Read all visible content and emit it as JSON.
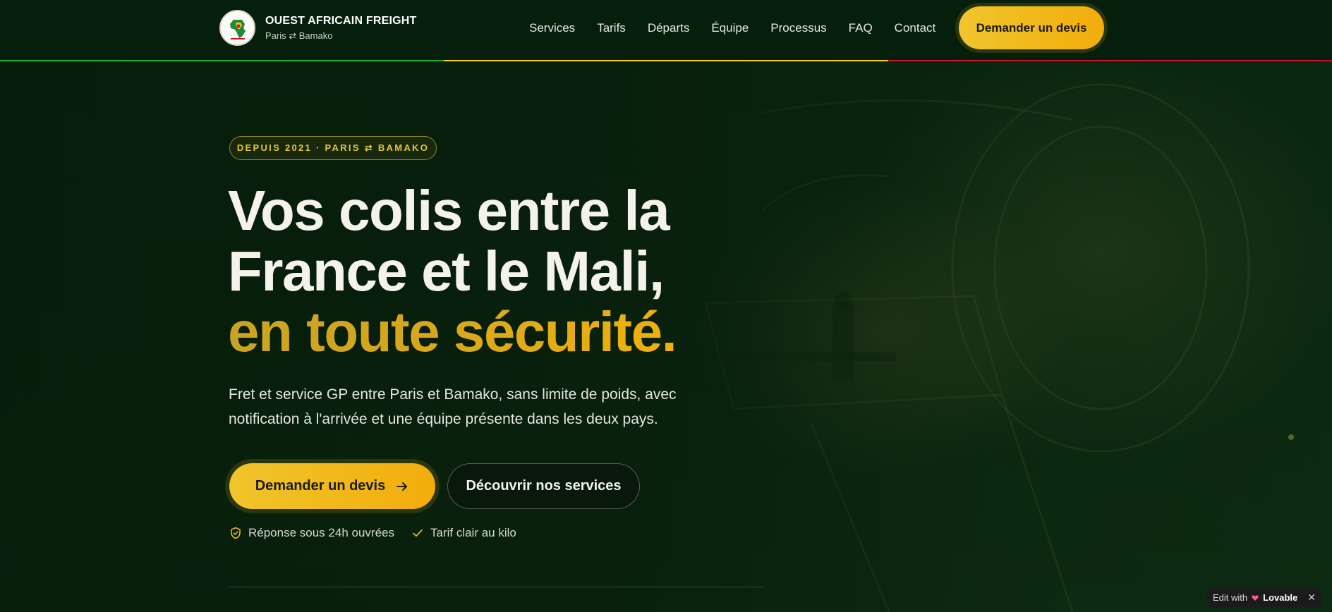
{
  "brand": {
    "name": "OUEST AFRICAIN FREIGHT",
    "subtitle": "Paris ⇄ Bamako"
  },
  "nav": {
    "items": [
      {
        "label": "Services"
      },
      {
        "label": "Tarifs"
      },
      {
        "label": "Départs"
      },
      {
        "label": "Équipe"
      },
      {
        "label": "Processus"
      },
      {
        "label": "FAQ"
      },
      {
        "label": "Contact"
      }
    ],
    "cta_label": "Demander un devis"
  },
  "hero": {
    "badge": "DEPUIS 2021 · PARIS ⇄ BAMAKO",
    "headline_line1": "Vos colis entre la",
    "headline_line2": "France et le Mali,",
    "headline_accent": "en toute sécurité.",
    "lead": "Fret et service GP entre Paris et Bamako, sans limite de poids, avec notification à l'arrivée et une équipe présente dans les deux pays.",
    "primary_button": "Demander un devis",
    "secondary_button": "Découvrir nos services",
    "features": [
      {
        "icon": "shield-check-icon",
        "label": "Réponse sous 24h ouvrées"
      },
      {
        "icon": "check-icon",
        "label": "Tarif clair au kilo"
      }
    ]
  },
  "lovable_badge": {
    "prefix": "Edit with",
    "word": "Lovable",
    "close": "✕"
  },
  "colors": {
    "accent_yellow": "#f0b90f",
    "background_green": "#0b2410",
    "flag_green": "#14b53a",
    "flag_yellow": "#fcd116",
    "flag_red": "#ce1126"
  }
}
